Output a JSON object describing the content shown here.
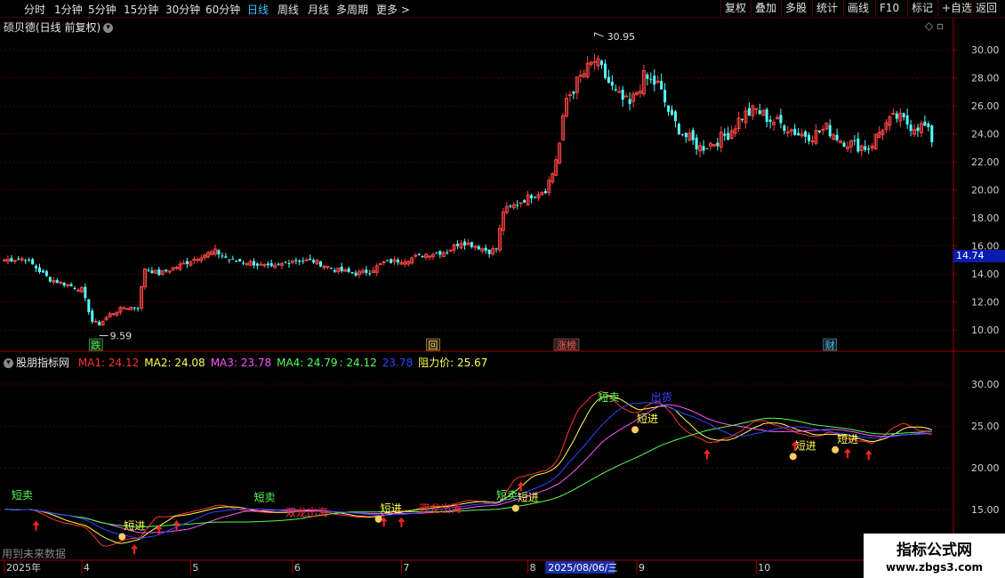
{
  "toolbar": {
    "left": [
      "分时",
      "1分钟",
      "5分钟",
      "15分钟",
      "30分钟",
      "60分钟",
      "日线",
      "周线",
      "月线",
      "多周期",
      "更多 >"
    ],
    "active": "日线",
    "right": [
      "复权",
      "叠加",
      "多股",
      "统计",
      "画线",
      "F10",
      "标记",
      "+自选",
      "返回"
    ]
  },
  "stock": {
    "title": "硕贝德(日线 前复权)",
    "high_label": "30.95",
    "low_label": "9.59",
    "last_price": "14.74"
  },
  "corner_icons": "◇ ▫",
  "price_axis": [
    "30.00",
    "28.00",
    "26.00",
    "24.00",
    "22.00",
    "20.00",
    "18.00",
    "16.00",
    "14.00",
    "12.00",
    "10.00"
  ],
  "event_markers": [
    {
      "label": "跌",
      "color": "#33ff33",
      "day": 26
    },
    {
      "label": "回",
      "color": "#ffcc33",
      "day": 122
    },
    {
      "label": "涨榜",
      "color": "#ff5555",
      "day": 160
    },
    {
      "label": "财",
      "color": "#33c7ff",
      "day": 235
    }
  ],
  "indicator": {
    "name": "股朋指标网",
    "items": [
      {
        "text": "MA1: 24.12",
        "color": "#ff3333"
      },
      {
        "text": "MA2: 24.08",
        "color": "#ffff55"
      },
      {
        "text": "MA3: 23.78",
        "color": "#ff55ff"
      },
      {
        "text": "MA4: 24.79",
        "color": "#55ff55"
      },
      {
        "text": ": 24.12",
        "color": "#55ff55"
      },
      {
        "text": "23.78",
        "color": "#3344ff"
      },
      {
        "text": "阻力价: 25.67",
        "color": "#ffff55"
      }
    ],
    "axis": [
      "30.00",
      "25.00",
      "20.00",
      "15.00"
    ],
    "signals": [
      {
        "text": "短卖",
        "color": "#55ff55",
        "day": 2,
        "v": 16.3
      },
      {
        "text": "短进",
        "color": "#ffff55",
        "day": 34,
        "v": 12.6
      },
      {
        "text": "短卖",
        "color": "#55ff55",
        "day": 71,
        "v": 16.0
      },
      {
        "text": "双龙出海",
        "color": "#ff3333",
        "day": 80,
        "v": 14.2
      },
      {
        "text": "短进",
        "color": "#ffff55",
        "day": 107,
        "v": 14.7
      },
      {
        "text": "双龙出海",
        "color": "#ff3333",
        "day": 118,
        "v": 14.7
      },
      {
        "text": "短卖",
        "color": "#55ff55",
        "day": 140,
        "v": 16.3
      },
      {
        "text": "短进",
        "color": "#ffff55",
        "day": 146,
        "v": 16.0
      },
      {
        "text": "短卖",
        "color": "#55ff55",
        "day": 169,
        "v": 28.0
      },
      {
        "text": "出货",
        "color": "#3344ff",
        "day": 184,
        "v": 28.0
      },
      {
        "text": "短进",
        "color": "#ffff55",
        "day": 180,
        "v": 25.4
      },
      {
        "text": "短进",
        "color": "#ffff55",
        "day": 225,
        "v": 22.2
      },
      {
        "text": "短进",
        "color": "#ffff55",
        "day": 237,
        "v": 23.0
      }
    ],
    "arrows": [
      9,
      37,
      44,
      49,
      108,
      113,
      147,
      200,
      225,
      240,
      246
    ]
  },
  "date_axis": [
    {
      "label": "2025年",
      "day": 0
    },
    {
      "label": "4",
      "day": 22
    },
    {
      "label": "5",
      "day": 53
    },
    {
      "label": "6",
      "day": 82
    },
    {
      "label": "7",
      "day": 113
    },
    {
      "label": "8",
      "day": 149
    },
    {
      "label": "9",
      "day": 180
    },
    {
      "label": "10",
      "day": 214
    }
  ],
  "date_highlight": {
    "label": "2025/08/06/三",
    "day": 154
  },
  "future_note": "用到未来数据",
  "watermark": {
    "line1": "指标公式网",
    "line2": "www.zbgs3.com"
  },
  "chart_data": {
    "type": "candlestick",
    "title": "硕贝德(日线 前复权)",
    "ylim": [
      9.0,
      31.0
    ],
    "anchors": [
      [
        0,
        15.0
      ],
      [
        6,
        15.1
      ],
      [
        10,
        14.2
      ],
      [
        13,
        13.6
      ],
      [
        18,
        13.2
      ],
      [
        22,
        12.9
      ],
      [
        25,
        10.6
      ],
      [
        27,
        10.4
      ],
      [
        30,
        11.1
      ],
      [
        34,
        11.6
      ],
      [
        38,
        11.6
      ],
      [
        40,
        14.4
      ],
      [
        44,
        14.0
      ],
      [
        50,
        14.6
      ],
      [
        56,
        15.3
      ],
      [
        60,
        15.6
      ],
      [
        64,
        15.0
      ],
      [
        70,
        14.8
      ],
      [
        76,
        14.4
      ],
      [
        82,
        15.0
      ],
      [
        88,
        14.9
      ],
      [
        94,
        14.3
      ],
      [
        100,
        14.0
      ],
      [
        104,
        14.2
      ],
      [
        108,
        14.8
      ],
      [
        114,
        15.0
      ],
      [
        120,
        15.4
      ],
      [
        126,
        15.6
      ],
      [
        130,
        16.3
      ],
      [
        134,
        16.0
      ],
      [
        138,
        15.6
      ],
      [
        140,
        15.8
      ],
      [
        142,
        18.5
      ],
      [
        146,
        19.0
      ],
      [
        150,
        19.6
      ],
      [
        154,
        20.0
      ],
      [
        156,
        21.2
      ],
      [
        158,
        23.3
      ],
      [
        160,
        26.5
      ],
      [
        164,
        28.0
      ],
      [
        168,
        29.2
      ],
      [
        170,
        28.5
      ],
      [
        174,
        26.8
      ],
      [
        178,
        26.0
      ],
      [
        182,
        28.0
      ],
      [
        186,
        27.5
      ],
      [
        190,
        25.0
      ],
      [
        194,
        23.8
      ],
      [
        198,
        23.0
      ],
      [
        202,
        23.4
      ],
      [
        206,
        24.0
      ],
      [
        210,
        25.3
      ],
      [
        214,
        25.7
      ],
      [
        218,
        25.0
      ],
      [
        222,
        24.6
      ],
      [
        226,
        24.0
      ],
      [
        230,
        23.9
      ],
      [
        234,
        24.4
      ],
      [
        238,
        23.6
      ],
      [
        242,
        23.2
      ],
      [
        246,
        23.0
      ],
      [
        250,
        24.5
      ],
      [
        254,
        25.2
      ],
      [
        258,
        24.6
      ],
      [
        262,
        24.5
      ],
      [
        264,
        23.6
      ]
    ],
    "moving_averages": [
      {
        "name": "MA1",
        "color": "#ff3333",
        "final": 24.12
      },
      {
        "name": "MA2",
        "color": "#ffff55",
        "final": 24.08
      },
      {
        "name": "MA3",
        "color": "#ff55ff",
        "final": 23.78
      },
      {
        "name": "MA4",
        "color": "#55ff55",
        "final": 24.79
      }
    ],
    "indicator_ylim": [
      11.0,
      33.0
    ]
  }
}
